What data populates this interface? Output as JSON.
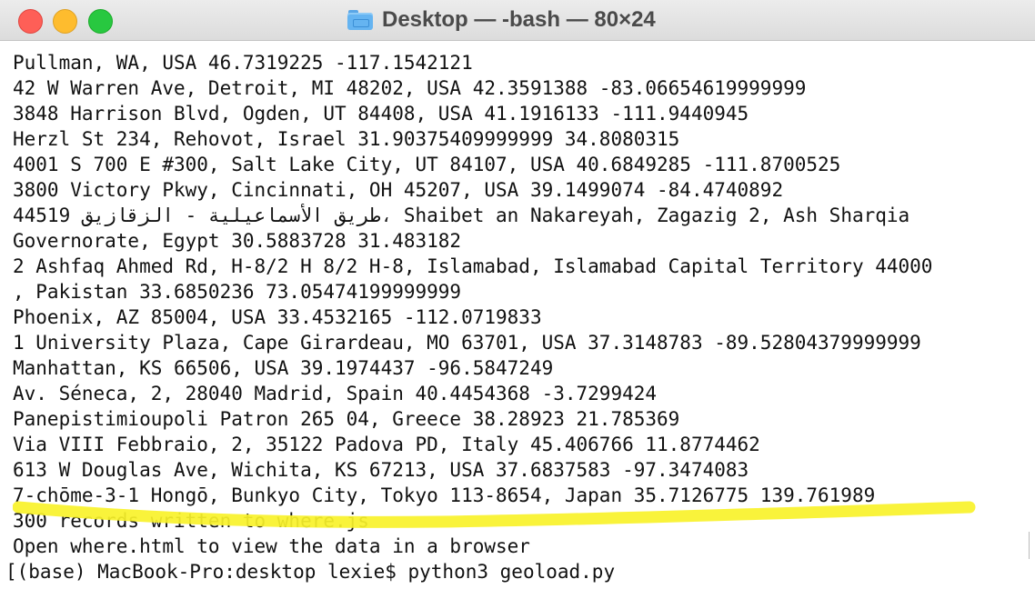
{
  "window": {
    "title": "Desktop — -bash — 80×24",
    "folder_icon": "folder-icon",
    "controls": {
      "close": "#fe5f57",
      "minimize": "#febc2e",
      "zoom": "#28c840"
    }
  },
  "terminal": {
    "lines": [
      "Pullman, WA, USA 46.7319225 -117.1542121",
      "42 W Warren Ave, Detroit, MI 48202, USA 42.3591388 -83.06654619999999",
      "3848 Harrison Blvd, Ogden, UT 84408, USA 41.1916133 -111.9440945",
      "Herzl St 234, Rehovot, Israel 31.90375409999999 34.8080315",
      "4001 S 700 E #300, Salt Lake City, UT 84107, USA 40.6849285 -111.8700525",
      "3800 Victory Pkwy, Cincinnati, OH 45207, USA 39.1499074 -84.4740892",
      "44519 طريق الأسماعيلية - الزقازيق، Shaibet an Nakareyah, Zagazig 2, Ash Sharqia",
      "Governorate, Egypt 30.5883728 31.483182",
      "2 Ashfaq Ahmed Rd, H-8/2 H 8/2 H-8, Islamabad, Islamabad Capital Territory 44000",
      ", Pakistan 33.6850236 73.05474199999999",
      "Phoenix, AZ 85004, USA 33.4532165 -112.0719833",
      "1 University Plaza, Cape Girardeau, MO 63701, USA 37.3148783 -89.52804379999999",
      "Manhattan, KS 66506, USA 39.1974437 -96.5847249",
      "Av. Séneca, 2, 28040 Madrid, Spain 40.4454368 -3.7299424",
      "Panepistimioupoli Patron 265 04, Greece 38.28923 21.785369",
      "Via VIII Febbraio, 2, 35122 Padova PD, Italy 45.406766 11.8774462",
      "613 W Douglas Ave, Wichita, KS 67213, USA 37.6837583 -97.3474083",
      "7-chōme-3-1 Hongō, Bunkyo City, Tokyo 113-8654, Japan 35.7126775 139.761989",
      "300 records written to where.js",
      "Open where.html to view the data in a browser",
      "[(base) MacBook-Pro:desktop lexie$ python3 geoload.py"
    ],
    "highlight_color": "#f8f22a"
  }
}
